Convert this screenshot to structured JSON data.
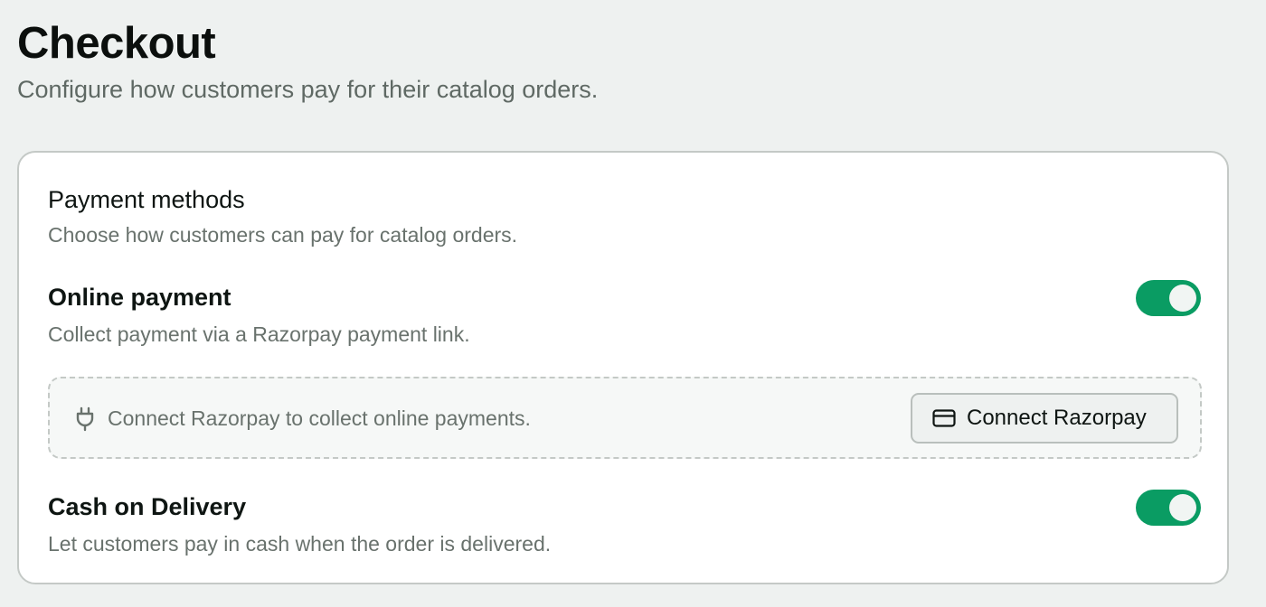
{
  "header": {
    "title": "Checkout",
    "subtitle": "Configure how customers pay for their catalog orders."
  },
  "payment_methods": {
    "title": "Payment methods",
    "description": "Choose how customers can pay for catalog orders.",
    "online_payment": {
      "label": "Online payment",
      "description": "Collect payment via a Razorpay payment link.",
      "enabled": true
    },
    "razorpay_connect": {
      "icon": "plug-icon",
      "message": "Connect Razorpay to collect online payments.",
      "button_icon": "credit-card-icon",
      "button_label": "Connect Razorpay"
    },
    "cash_on_delivery": {
      "label": "Cash on Delivery",
      "description": "Let customers pay in cash when the order is delivered.",
      "enabled": true
    }
  },
  "colors": {
    "page_background": "#eef1f0",
    "card_background": "#ffffff",
    "toggle_on": "#0a9c63",
    "muted_text": "#69726d"
  }
}
